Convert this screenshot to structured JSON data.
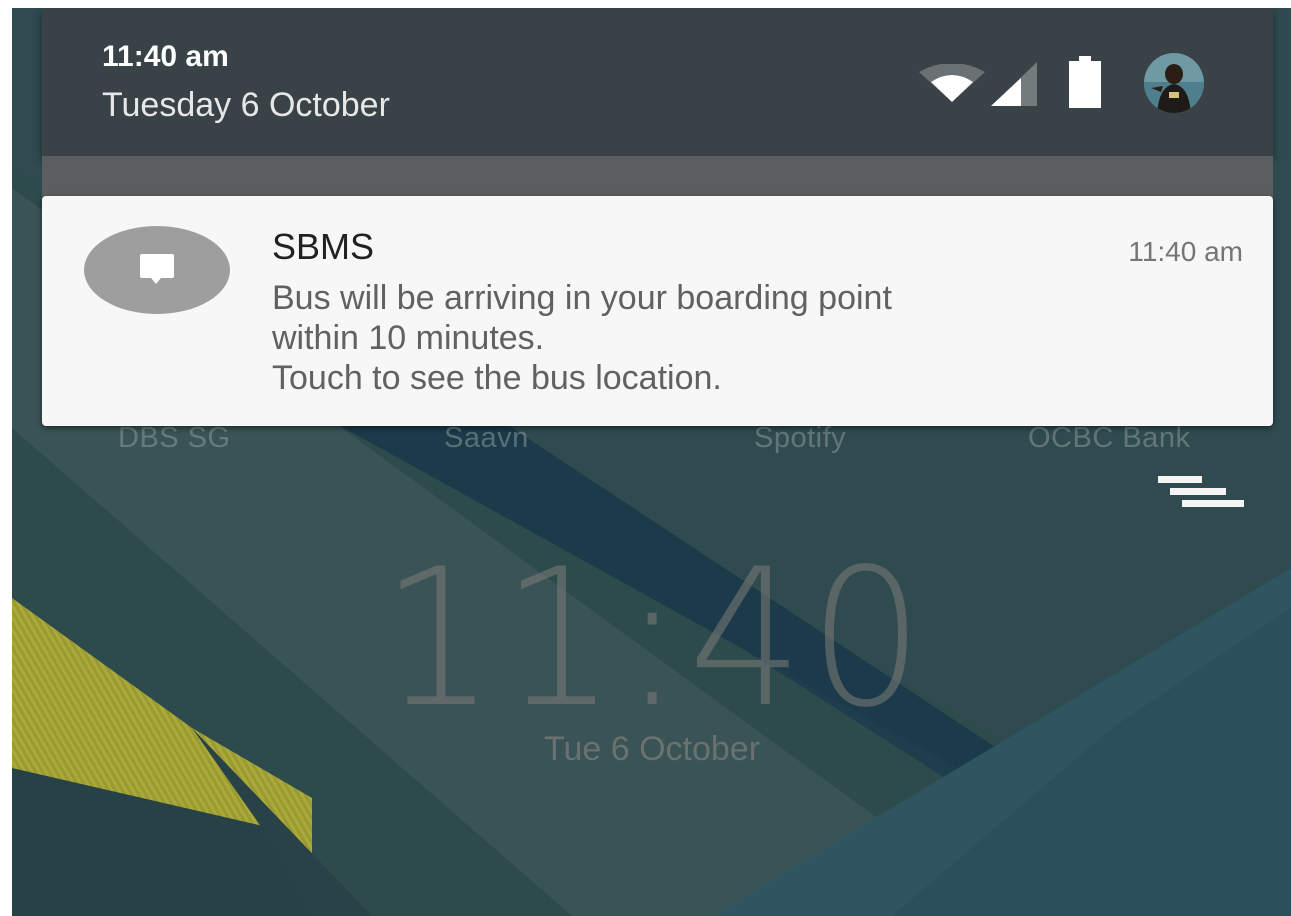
{
  "header": {
    "time": "11:40 am",
    "date": "Tuesday 6 October"
  },
  "status_bar": {
    "icons": [
      "wifi-icon",
      "cellular-signal-icon",
      "battery-icon",
      "user-avatar"
    ]
  },
  "notification": {
    "app_name": "SBMS",
    "time": "11:40 am",
    "icon": "chat-bubble-icon",
    "body_lines": [
      "Bus will be arriving in your boarding point",
      "within 10 minutes.",
      "Touch to see the bus location."
    ]
  },
  "home_apps": [
    "DBS SG",
    "Saavn",
    "Spotify",
    "OCBC Bank"
  ],
  "lockscreen": {
    "clock": "11:40",
    "date": "Tue 6 October"
  },
  "colors": {
    "header_bg": "#394246",
    "notification_bg": "#f7f7f7",
    "wallpaper_base": "#2e4a4e",
    "accent_yellow": "#a8a833"
  }
}
